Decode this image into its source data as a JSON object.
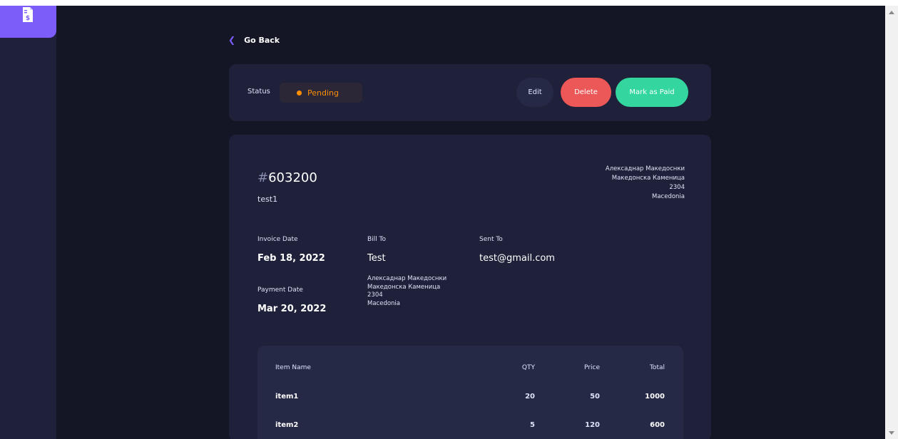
{
  "nav": {
    "go_back_label": "Go Back"
  },
  "status": {
    "label": "Status",
    "value": "Pending",
    "color": "#ff8f00"
  },
  "actions": {
    "edit_label": "Edit",
    "delete_label": "Delete",
    "mark_paid_label": "Mark as Paid"
  },
  "invoice": {
    "id_hash": "#",
    "id": "603200",
    "description": "test1",
    "sender_address": {
      "name": "Алексаднар Македоснки",
      "street": "Македонска Каменица",
      "postcode": "2304",
      "country": "Macedonia"
    },
    "invoice_date_label": "Invoice Date",
    "invoice_date": "Feb 18, 2022",
    "payment_date_label": "Payment Date",
    "payment_date": "Mar 20, 2022",
    "bill_to_label": "Bill To",
    "bill_to_name": "Test",
    "client_address": {
      "name": "Алексаднар Македоснки",
      "street": "Македонска Каменица",
      "postcode": "2304",
      "country": "Macedonia"
    },
    "sent_to_label": "Sent To",
    "sent_to_email": "test@gmail.com"
  },
  "items": {
    "headers": {
      "name": "Item Name",
      "qty": "QTY",
      "price": "Price",
      "total": "Total"
    },
    "rows": [
      {
        "name": "item1",
        "qty": "20",
        "price": "50",
        "total": "1000"
      },
      {
        "name": "item2",
        "qty": "5",
        "price": "120",
        "total": "600"
      }
    ]
  },
  "colors": {
    "accent": "#7c5dfa",
    "delete": "#ec5757",
    "paid": "#33d69f",
    "pending": "#ff8f00"
  },
  "icons": {
    "logo": "invoice-dollar-icon",
    "back": "chevron-left-icon"
  }
}
